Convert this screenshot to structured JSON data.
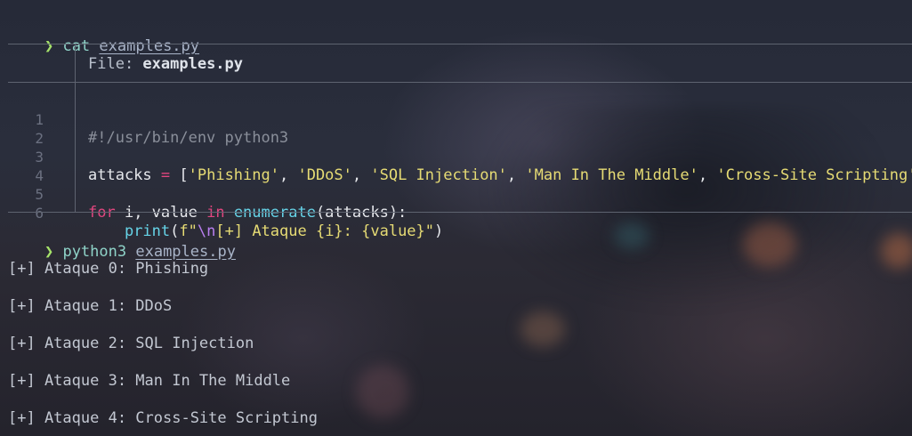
{
  "colors": {
    "prompt_chevron": "#a6e36a",
    "command": "#8fd3c8",
    "keyword": "#e2467f",
    "string": "#e6db74",
    "function": "#66d4e8",
    "comment": "#8a8f9a"
  },
  "prompt1": {
    "symbol": "❯",
    "command": "cat",
    "argument": "examples.py"
  },
  "file_view": {
    "header_label": "File: ",
    "file_name": "examples.py",
    "line_numbers": [
      "1",
      "2",
      "3",
      "4",
      "5",
      "6"
    ],
    "line1": "#!/usr/bin/env python3",
    "line3": {
      "var": "attacks",
      "assign": " = ",
      "open": "[",
      "s1": "'Phishing'",
      "s2": "'DDoS'",
      "s3": "'SQL Injection'",
      "s4": "'Man In The Middle'",
      "s5": "'Cross-Site Scripting'",
      "sep": ", ",
      "close": "]"
    },
    "line5": {
      "kw_for": "for",
      "vars": " i, value ",
      "kw_in": "in",
      "func": "enumerate",
      "args": "(attacks):"
    },
    "line6": {
      "indent": "    ",
      "func": "print",
      "paren": "(",
      "prefix": "f",
      "quote_open": "\"",
      "escape": "\\n",
      "text": "[+] Ataque {i}: {value}",
      "quote_close": "\"",
      "close": ")"
    }
  },
  "prompt2": {
    "symbol": "❯",
    "command": "python3",
    "argument": "examples.py"
  },
  "output_lines": [
    "[+] Ataque 0: Phishing",
    "[+] Ataque 1: DDoS",
    "[+] Ataque 2: SQL Injection",
    "[+] Ataque 3: Man In The Middle",
    "[+] Ataque 4: Cross-Site Scripting"
  ]
}
